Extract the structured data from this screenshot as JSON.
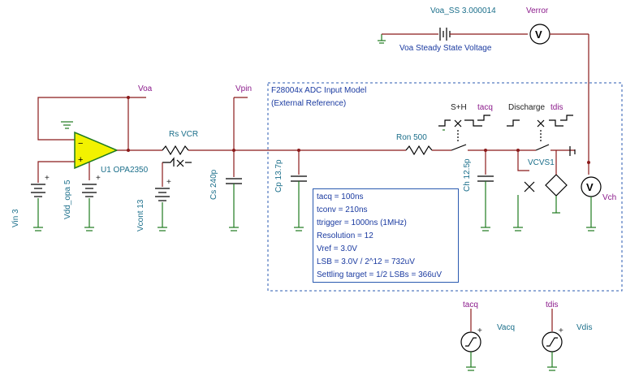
{
  "labels": {
    "voa_ss": "Voa_SS 3.000014",
    "verror": "Verror",
    "voa_steady": "Voa Steady State Voltage",
    "voa": "Voa",
    "vpin": "Vpin",
    "adc_model": "F28004x ADC Input Model",
    "ext_ref": "(External Reference)",
    "sh": "S+H",
    "tacq_sw": "tacq",
    "discharge": "Discharge",
    "tdis_sw": "tdis",
    "rs": "Rs VCR",
    "ron": "Ron 500",
    "vcvs": "VCVS1",
    "u1": "U1 OPA2350",
    "vin": "Vin 3",
    "vdd": "Vdd_opa 5",
    "vcont": "Vcont 13",
    "cs": "Cs 240p",
    "cp": "Cp 13.7p",
    "ch": "Ch 12.5p",
    "vch": "Vch",
    "tacq_src": "tacq",
    "vacq": "Vacq",
    "tdis_src": "tdis",
    "vdis": "Vdis",
    "meter_symbol": "V"
  },
  "notes": [
    "tacq = 100ns",
    "tconv = 210ns",
    "ttrigger = 1000ns (1MHz)",
    "Resolution = 12",
    "Vref = 3.0V",
    "LSB = 3.0V / 2^12 = 732uV",
    "Settling target = 1/2 LSBs = 366uV"
  ]
}
